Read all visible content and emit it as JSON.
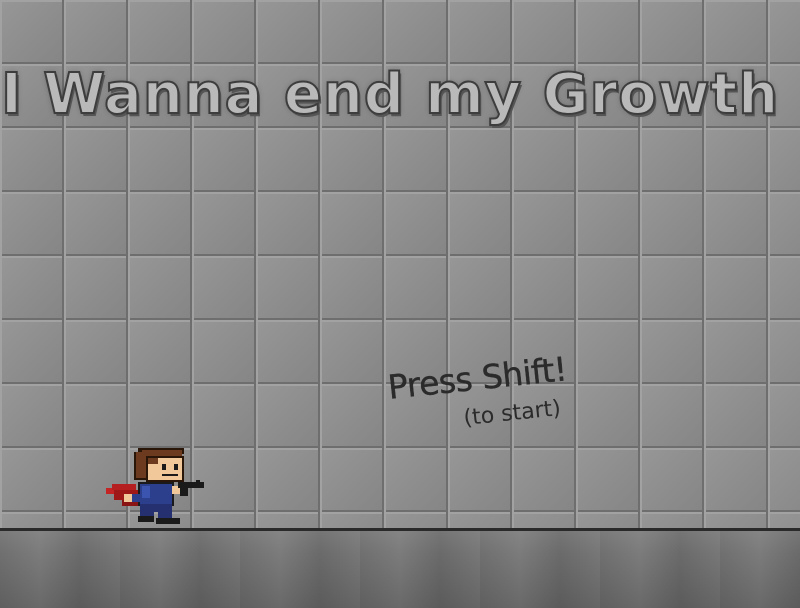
{
  "game": {
    "title": "I Wanna end my Growth",
    "prompt": {
      "main": "Press Shift!",
      "sub": "(to start)"
    }
  },
  "colors": {
    "wall_tile": "#8e8e8e",
    "floor": "#747474",
    "title_fill": "#b9b9b9",
    "title_outline": "#3d3d3d",
    "cape": "#b51f1f",
    "shirt": "#2c3f8c",
    "hair": "#6b3a1f",
    "skin": "#f1c89a",
    "gun": "#1a1a1a"
  }
}
